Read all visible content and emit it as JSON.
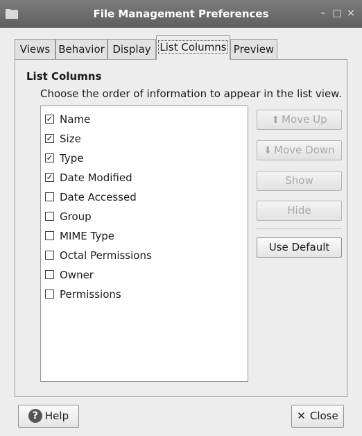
{
  "window": {
    "title": "File Management Preferences",
    "minimize_glyph": "–",
    "maximize_glyph": "□",
    "close_glyph": "×"
  },
  "tabs": [
    {
      "label": "Views"
    },
    {
      "label": "Behavior"
    },
    {
      "label": "Display"
    },
    {
      "label": "List Columns",
      "active": true
    },
    {
      "label": "Preview"
    }
  ],
  "section": {
    "title": "List Columns",
    "description": "Choose the order of information to appear in the list view."
  },
  "columns": [
    {
      "label": "Name",
      "checked": true
    },
    {
      "label": "Size",
      "checked": true
    },
    {
      "label": "Type",
      "checked": true
    },
    {
      "label": "Date Modified",
      "checked": true
    },
    {
      "label": "Date Accessed",
      "checked": false
    },
    {
      "label": "Group",
      "checked": false
    },
    {
      "label": "MIME Type",
      "checked": false
    },
    {
      "label": "Octal Permissions",
      "checked": false
    },
    {
      "label": "Owner",
      "checked": false
    },
    {
      "label": "Permissions",
      "checked": false
    }
  ],
  "buttons": {
    "move_up": {
      "label": "Move Up",
      "enabled": false
    },
    "move_down": {
      "label": "Move Down",
      "enabled": false
    },
    "show": {
      "label": "Show",
      "enabled": false
    },
    "hide": {
      "label": "Hide",
      "enabled": false
    },
    "use_default": {
      "label": "Use Default",
      "enabled": true
    },
    "help": {
      "label": "Help",
      "icon": "help-icon"
    },
    "close": {
      "label": "Close",
      "icon": "close-icon"
    }
  },
  "colors": {
    "titlebar": "#666666",
    "window_bg": "#ededed",
    "list_bg": "#ffffff",
    "disabled_text": "#a8a8a8"
  }
}
